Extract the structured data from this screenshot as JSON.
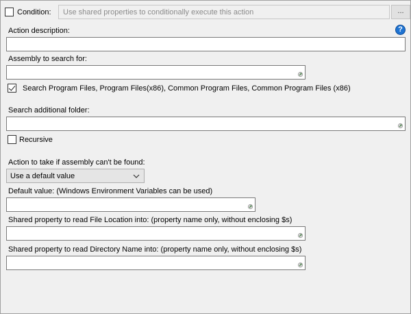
{
  "condition": {
    "label": "Condition:",
    "placeholder": "Use shared properties to conditionally execute this action",
    "button_label": "...",
    "checked": false
  },
  "action_description": {
    "label": "Action description:",
    "value": ""
  },
  "help_icon": {
    "glyph": "?",
    "icon": "help-icon"
  },
  "assembly": {
    "label": "Assembly to search for:",
    "value": ""
  },
  "search_program_files": {
    "label": "Search Program Files, Program Files(x86), Common Program Files, Common Program Files (x86)",
    "checked": true
  },
  "search_additional_folder": {
    "label": "Search additional folder:",
    "value": ""
  },
  "recursive": {
    "label": "Recursive",
    "checked": false
  },
  "action_if_not_found": {
    "label": "Action to take if assembly can't be found:",
    "selected": "Use a default value"
  },
  "default_value": {
    "label": "Default value: (Windows Environment Variables can be used)",
    "value": ""
  },
  "file_location_property": {
    "label": "Shared property to read File Location into: (property name only, without enclosing $s)",
    "value": ""
  },
  "directory_name_property": {
    "label": "Shared property to read Directory Name into: (property name only, without enclosing $s)",
    "value": ""
  },
  "colors": {
    "panel_bg": "#f0f0f0",
    "help_blue": "#1e73d2",
    "field_border": "#7a7a7a"
  }
}
